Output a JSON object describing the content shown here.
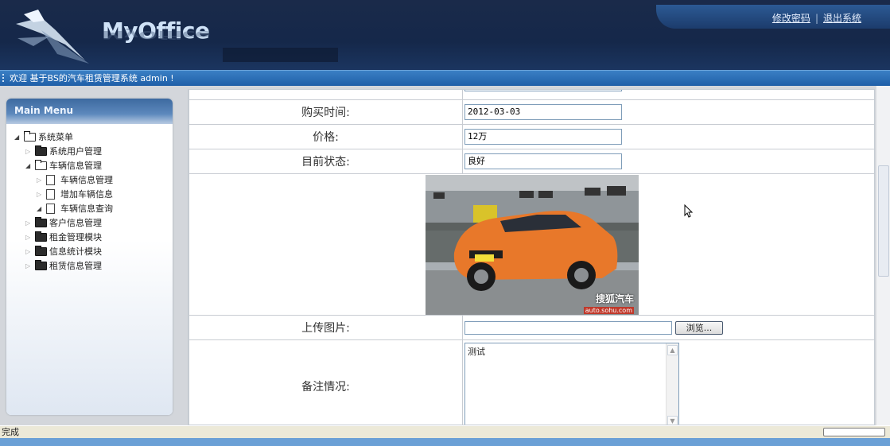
{
  "header": {
    "logo_text": "MyOffice",
    "links": {
      "change_password": "修改密码",
      "logout": "退出系统",
      "separator": "|"
    }
  },
  "welcome": {
    "text": "欢迎 基于BS的汽车租赁管理系统 admin !"
  },
  "sidebar": {
    "title": "Main Menu",
    "tree": [
      {
        "label": "系统菜单",
        "level": 0,
        "type": "folder",
        "expanded": true
      },
      {
        "label": "系统用户管理",
        "level": 1,
        "type": "folder",
        "expanded": false
      },
      {
        "label": "车辆信息管理",
        "level": 1,
        "type": "folder",
        "expanded": true
      },
      {
        "label": "车辆信息管理",
        "level": 2,
        "type": "file"
      },
      {
        "label": "增加车辆信息",
        "level": 2,
        "type": "file"
      },
      {
        "label": "车辆信息查询",
        "level": 2,
        "type": "file"
      },
      {
        "label": "客户信息管理",
        "level": 1,
        "type": "folder",
        "expanded": false
      },
      {
        "label": "租金管理模块",
        "level": 1,
        "type": "folder",
        "expanded": false
      },
      {
        "label": "信息统计模块",
        "level": 1,
        "type": "folder",
        "expanded": false
      },
      {
        "label": "租赁信息管理",
        "level": 1,
        "type": "folder",
        "expanded": false
      }
    ]
  },
  "form": {
    "purchase_time": {
      "label": "购买时间:",
      "value": "2012-03-03"
    },
    "price": {
      "label": "价格:",
      "value": "12万"
    },
    "status": {
      "label": "目前状态:",
      "value": "良好"
    },
    "photo": {
      "watermark": "搜狐汽车",
      "watermark_url": "auto.sohu.com"
    },
    "upload": {
      "label": "上传图片:",
      "button": "浏览..."
    },
    "remarks": {
      "label": "备注情况:",
      "value": "测试"
    }
  },
  "statusbar": {
    "text": "完成"
  },
  "colors": {
    "header_bg": "#15284a",
    "welcome_bar": "#1f5fa8",
    "car_orange": "#e8782a"
  }
}
